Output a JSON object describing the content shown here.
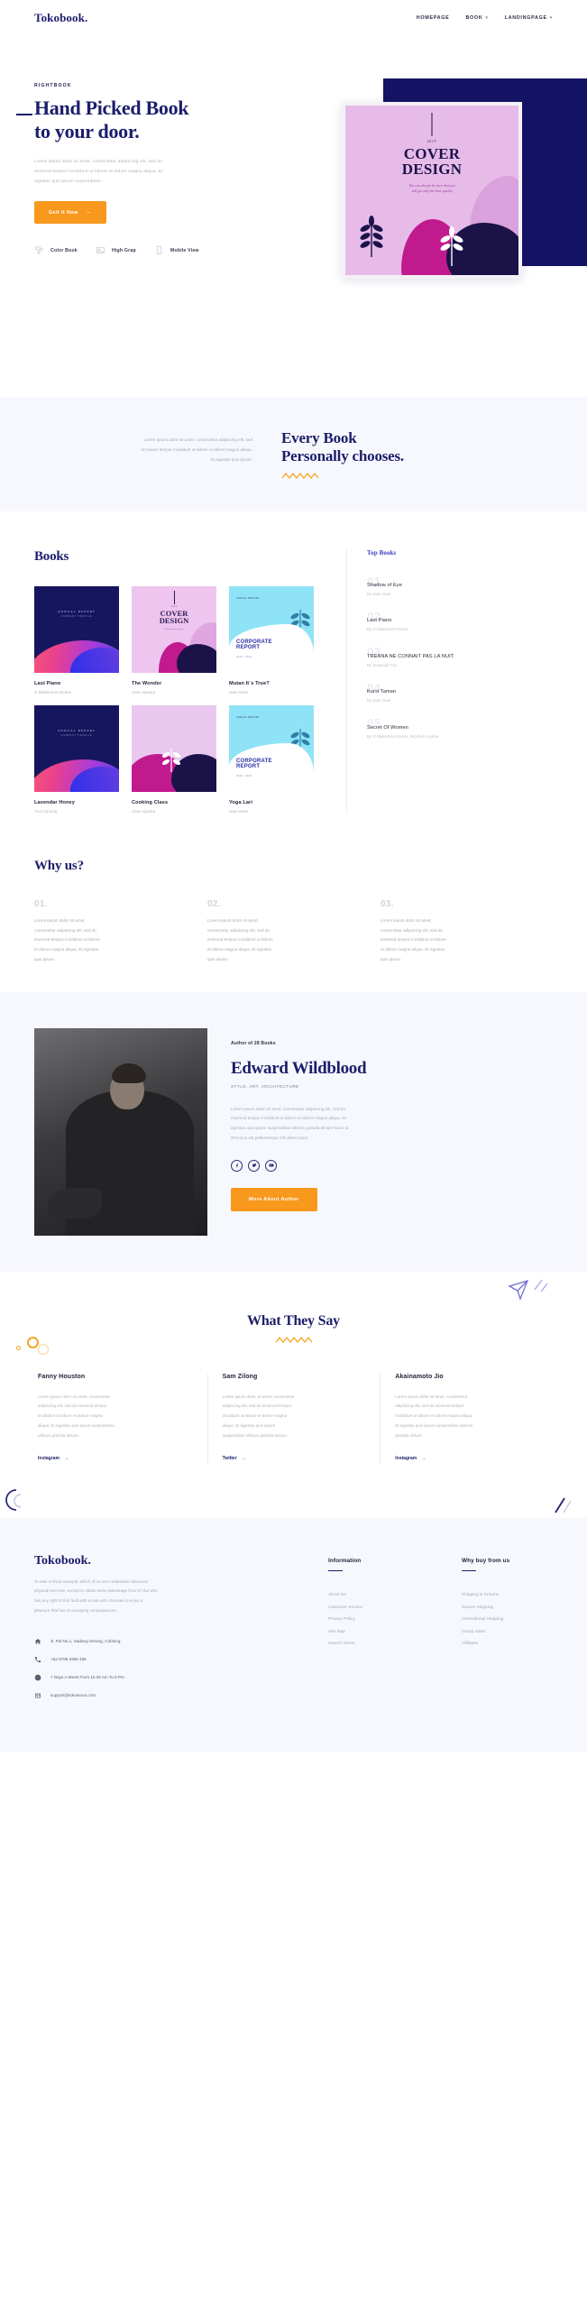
{
  "header": {
    "logo": "Tokobook.",
    "nav": [
      {
        "label": "HOMEPAGE",
        "caret": false
      },
      {
        "label": "BOOK",
        "caret": true
      },
      {
        "label": "LANDINGPAGE",
        "caret": true
      }
    ]
  },
  "hero": {
    "kicker": "RIGHTBOOK",
    "title_line1": "Hand Picked Book",
    "title_line2": "to your door.",
    "paragraph_lines": [
      "Lorem ipsum dolor sit amet, consectetur adipiscing elit, sed do",
      "eiusmod tempor incididunt ut labore et dolore magna aliqua. Et",
      "egestas quis ipsum suspendisse."
    ],
    "cta": "Geit It Now",
    "cta_arrow": "→",
    "features": [
      {
        "label": "Color Book",
        "icon": "paint-roller-icon"
      },
      {
        "label": "High Grap",
        "icon": "image-icon"
      },
      {
        "label": "Mobile View",
        "icon": "mobile-icon"
      }
    ],
    "cover": {
      "year": "2019",
      "title_line1": "COVER",
      "title_line2": "DESIGN",
      "subtitle_line1": "You can always be sure that you",
      "subtitle_line2": "will get only the best quality"
    }
  },
  "band": {
    "paragraph_lines": [
      "Lorem ipsum dolor sit amet, consectetur adipiscing elit, sed",
      "do eiusm tempor incididunt ut labore et dolore magna aliqua.",
      "Et egestas quis ipsum."
    ],
    "title_line1": "Every Book",
    "title_line2": "Personally chooses."
  },
  "books": {
    "section_title": "Books",
    "grid": [
      {
        "name": "Last Piano",
        "author": "G Blakemore Evans",
        "style": "tn-dark"
      },
      {
        "name": "The Wonder",
        "author": "Ama Aipama",
        "style": "tn-pink"
      },
      {
        "name": "Mutan It`s True?",
        "author": "Iwan Gaet",
        "style": "tn-cyan"
      },
      {
        "name": "Lavendar Honey",
        "author": "Yuni Ayunda",
        "style": "tn-dark"
      },
      {
        "name": "Cooking Class",
        "author": "Ama Aipama",
        "style": "tn-bot"
      },
      {
        "name": "Yoga Lari",
        "author": "Iwan Gaet",
        "style": "tn-cyan"
      }
    ],
    "cover_card": {
      "year": "2019",
      "title_line1": "COVER",
      "title_line2": "DESIGN",
      "subtitle": "You can always be sure"
    },
    "cyan_card": {
      "heading": "ANNUAL REPORT",
      "title_line1": "CORPORATE",
      "title_line2": "REPORT",
      "subtitle": "2019 / 2020"
    },
    "dark_card": {
      "label": "ANNUAL REPORT",
      "sub": "COMPANY PROFILE"
    },
    "top_books_title": "Top Books",
    "top_books": [
      {
        "num": "01",
        "name": "Shadow of Eye",
        "by": "By Iwan Gaet"
      },
      {
        "num": "02",
        "name": "Last Piano",
        "by": "By G Blakemore Evans"
      },
      {
        "num": "03",
        "name": "TREANA NE CONNAIT PAS LA NUIT",
        "by": "By Sukaesih Tuti"
      },
      {
        "num": "04",
        "name": "Kursi Taman",
        "by": "By Iwan Gaet"
      },
      {
        "num": "05",
        "name": "Secret Of Women",
        "by": "By G Blakemore Evans, Micshon Andrea"
      }
    ]
  },
  "why": {
    "title": "Why us?",
    "items": [
      {
        "num": "01.",
        "lines": [
          "Lorem ipsum dolor sit amet,",
          "consectetur adipiscing elit, sed do",
          "eiusmod tempor incididunt ut labore",
          "et dolore magna aliqua. Et egestas",
          "quis ipsum."
        ]
      },
      {
        "num": "02.",
        "lines": [
          "Lorem ipsum dolor sit amet,",
          "consectetur adipiscing elit, sed do",
          "eiusmod tempor incididunt ut labore",
          "et dolore magna aliqua. Et egestas",
          "quis ipsum."
        ]
      },
      {
        "num": "03.",
        "lines": [
          "Lorem ipsum dolor sit amet,",
          "consectetur adipiscing elit, sed do",
          "eiusmod tempor incididunt ut labore",
          "et dolore magna aliqua. Et egestas",
          "quis ipsum."
        ]
      }
    ]
  },
  "author": {
    "kicker": "Author of 28 Books",
    "name": "Edward Wildblood",
    "tags": "STYLE, ART, ARCHITECTURE",
    "bio_lines": [
      "Lorem ipsum dolor sit amet, consectetur adipiscing elit, sed do",
      "eiusmod tempor incididunt ut labore et dolore magna aliqua. Et",
      "egestas quis ipsum suspendisse ultrices gravida dictum fusce ut.",
      "Rhoncus est pellentesque elit ullamcorper."
    ],
    "socials": [
      {
        "name": "facebook-icon"
      },
      {
        "name": "twitter-icon"
      },
      {
        "name": "youtube-icon"
      }
    ],
    "cta": "More About Author"
  },
  "testimonials": {
    "title": "What They Say",
    "items": [
      {
        "name": "Fanny Houston",
        "lines": [
          "Lorem ipsum dolor sit amet, consectetur",
          "adipiscing elit, sed do eiusmod tempor",
          "incididunt ut labore et dolore magna",
          "aliqua. Et egestas quis ipsum suspendisse",
          "ultrices gravida dictum."
        ],
        "link": "Instagram"
      },
      {
        "name": "Sam Zilong",
        "lines": [
          "Lorem ipsum dolor sit amet, consectetur",
          "adipiscing elit, sed do eiusmod tempor",
          "incididunt ut labore et dolore magna",
          "aliqua. Et egestas quis ipsum",
          "suspendisse ultrices gravida dictum."
        ],
        "link": "Twitter"
      },
      {
        "name": "Akainamoto Jio",
        "lines": [
          "Lorem ipsum dolor sit amet, consectetur",
          "adipiscing elit, sed do eiusmod tempor",
          "incididunt ut labore et dolore magna aliqua.",
          "Et egestas quis ipsum suspendisse ultrices",
          "gravida dictum."
        ],
        "link": "Instagram"
      }
    ],
    "link_arrow": "→"
  },
  "footer": {
    "logo": "Tokobook.",
    "desc_lines": [
      "To take a trivial example, which of us ever undertakes laborious",
      "physical exercise, except to obtain some advantage from it? But who",
      "has any right to find fault with a man who chooses to enjoy a",
      "pleasure that has no annoying consequences."
    ],
    "contacts": [
      {
        "icon": "home-icon",
        "text": "Jl. Piit No.1, Sadang Serang, Coblong"
      },
      {
        "icon": "phone-icon",
        "text": "+62 8798 6368 486"
      },
      {
        "icon": "clock-icon",
        "text": "7 Days A Week From 10.00 Am To 6 Pm"
      },
      {
        "icon": "mail-icon",
        "text": "support@tokomooo.com"
      }
    ],
    "columns": [
      {
        "title": "Information",
        "links": [
          "About Us",
          "Customer Service",
          "Privacy Policy",
          "Site Map",
          "Search Terms"
        ]
      },
      {
        "title": "Why buy from us",
        "links": [
          "Shipping & Returns",
          "Secure Shipping",
          "International Shipping",
          "Group Sales",
          "Affiliates"
        ]
      }
    ]
  },
  "colors": {
    "navy": "#1c1d6b",
    "orange": "#f8981d",
    "band_bg": "#f7f8fd",
    "muted": "#a9abb5"
  }
}
